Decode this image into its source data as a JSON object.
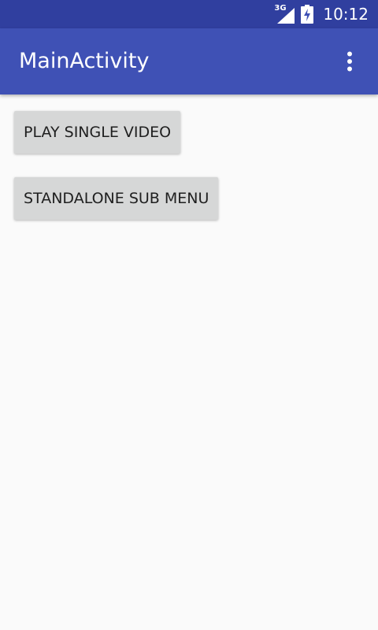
{
  "status_bar": {
    "network_type": "3G",
    "time": "10:12",
    "icons": [
      "signal-icon",
      "battery-charging-icon"
    ]
  },
  "app_bar": {
    "title": "MainActivity",
    "overflow_icon": "more-vert-icon"
  },
  "buttons": [
    {
      "label": "PLAY SINGLE VIDEO"
    },
    {
      "label": "STANDALONE SUB MENU"
    }
  ],
  "colors": {
    "status_bar": "#303f9f",
    "app_bar": "#3f51b5",
    "background": "#fafafa",
    "button": "#d6d7d7",
    "button_text": "#1f1f1f"
  }
}
